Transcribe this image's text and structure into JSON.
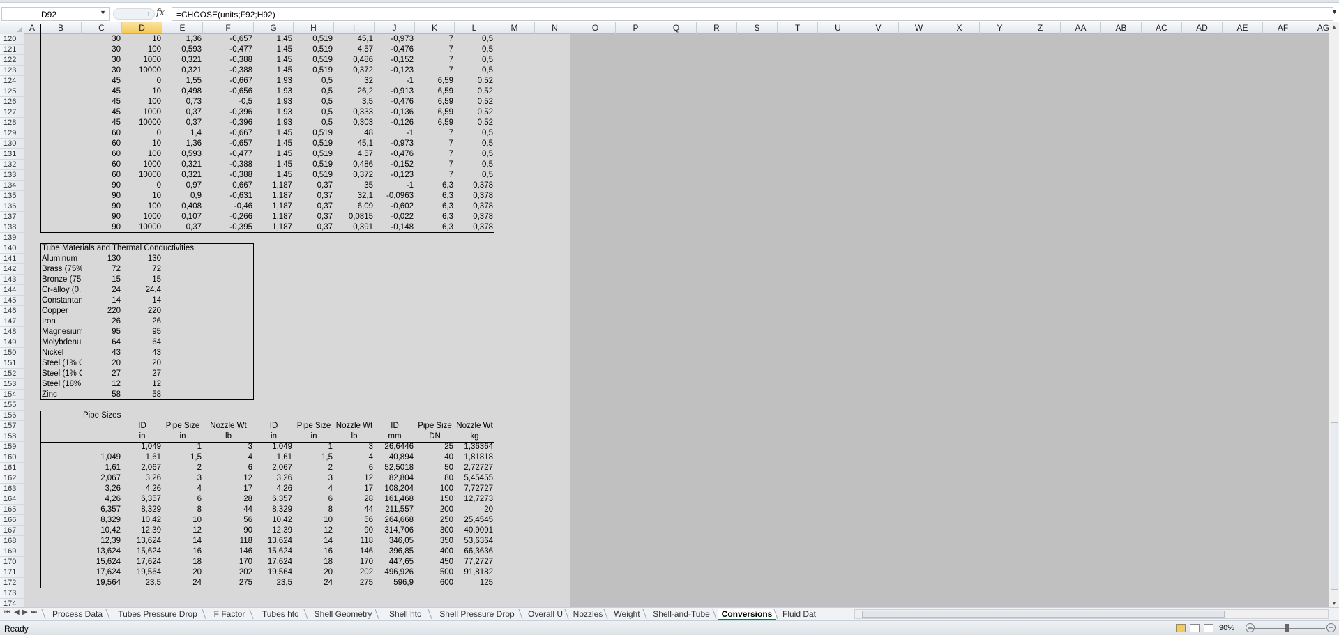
{
  "name_box": "D92",
  "formula": "=CHOOSE(units;F92;H92)",
  "fx_label": "fx",
  "columns": [
    "A",
    "B",
    "C",
    "D",
    "E",
    "F",
    "G",
    "H",
    "I",
    "J",
    "K",
    "L",
    "M",
    "N",
    "O",
    "P",
    "Q",
    "R",
    "S",
    "T",
    "U",
    "V",
    "W",
    "X",
    "Y",
    "Z",
    "AA",
    "AB",
    "AC",
    "AD",
    "AE",
    "AF",
    "AG"
  ],
  "selected_column": "D",
  "rows": [
    "120",
    "121",
    "122",
    "123",
    "124",
    "125",
    "126",
    "127",
    "128",
    "129",
    "130",
    "131",
    "132",
    "133",
    "134",
    "135",
    "136",
    "137",
    "138",
    "139",
    "140",
    "141",
    "142",
    "143",
    "144",
    "145",
    "146",
    "147",
    "148",
    "149",
    "150",
    "151",
    "152",
    "153",
    "154",
    "155",
    "156",
    "157",
    "158",
    "159",
    "160",
    "161",
    "162",
    "163",
    "164",
    "165",
    "166",
    "167",
    "168",
    "169",
    "170",
    "171",
    "172",
    "173",
    "174"
  ],
  "table1": [
    [
      "30",
      "10",
      "1,36",
      "-0,657",
      "1,45",
      "0,519",
      "45,1",
      "-0,973",
      "7",
      "0,5"
    ],
    [
      "30",
      "100",
      "0,593",
      "-0,477",
      "1,45",
      "0,519",
      "4,57",
      "-0,476",
      "7",
      "0,5"
    ],
    [
      "30",
      "1000",
      "0,321",
      "-0,388",
      "1,45",
      "0,519",
      "0,486",
      "-0,152",
      "7",
      "0,5"
    ],
    [
      "30",
      "10000",
      "0,321",
      "-0,388",
      "1,45",
      "0,519",
      "0,372",
      "-0,123",
      "7",
      "0,5"
    ],
    [
      "45",
      "0",
      "1,55",
      "-0,667",
      "1,93",
      "0,5",
      "32",
      "-1",
      "6,59",
      "0,52"
    ],
    [
      "45",
      "10",
      "0,498",
      "-0,656",
      "1,93",
      "0,5",
      "26,2",
      "-0,913",
      "6,59",
      "0,52"
    ],
    [
      "45",
      "100",
      "0,73",
      "-0,5",
      "1,93",
      "0,5",
      "3,5",
      "-0,476",
      "6,59",
      "0,52"
    ],
    [
      "45",
      "1000",
      "0,37",
      "-0,396",
      "1,93",
      "0,5",
      "0,333",
      "-0,136",
      "6,59",
      "0,52"
    ],
    [
      "45",
      "10000",
      "0,37",
      "-0,396",
      "1,93",
      "0,5",
      "0,303",
      "-0,126",
      "6,59",
      "0,52"
    ],
    [
      "60",
      "0",
      "1,4",
      "-0,667",
      "1,45",
      "0,519",
      "48",
      "-1",
      "7",
      "0,5"
    ],
    [
      "60",
      "10",
      "1,36",
      "-0,657",
      "1,45",
      "0,519",
      "45,1",
      "-0,973",
      "7",
      "0,5"
    ],
    [
      "60",
      "100",
      "0,593",
      "-0,477",
      "1,45",
      "0,519",
      "4,57",
      "-0,476",
      "7",
      "0,5"
    ],
    [
      "60",
      "1000",
      "0,321",
      "-0,388",
      "1,45",
      "0,519",
      "0,486",
      "-0,152",
      "7",
      "0,5"
    ],
    [
      "60",
      "10000",
      "0,321",
      "-0,388",
      "1,45",
      "0,519",
      "0,372",
      "-0,123",
      "7",
      "0,5"
    ],
    [
      "90",
      "0",
      "0,97",
      "0,667",
      "1,187",
      "0,37",
      "35",
      "-1",
      "6,3",
      "0,378"
    ],
    [
      "90",
      "10",
      "0,9",
      "-0,631",
      "1,187",
      "0,37",
      "32,1",
      "-0,0963",
      "6,3",
      "0,378"
    ],
    [
      "90",
      "100",
      "0,408",
      "-0,46",
      "1,187",
      "0,37",
      "6,09",
      "-0,602",
      "6,3",
      "0,378"
    ],
    [
      "90",
      "1000",
      "0,107",
      "-0,266",
      "1,187",
      "0,37",
      "0,0815",
      "-0,022",
      "6,3",
      "0,378"
    ],
    [
      "90",
      "10000",
      "0,37",
      "-0,395",
      "1,187",
      "0,37",
      "0,391",
      "-0,148",
      "6,3",
      "0,378"
    ]
  ],
  "table2": {
    "title": "Tube Materials and Thermal Conductivities",
    "rows": [
      [
        "Aluminum",
        "130",
        "130"
      ],
      [
        "Brass (75%",
        "72",
        "72"
      ],
      [
        "Bronze (75",
        "15",
        "15"
      ],
      [
        "Cr-alloy (0.",
        "24",
        "24,4"
      ],
      [
        "Constantan",
        "14",
        "14"
      ],
      [
        "Copper",
        "220",
        "220"
      ],
      [
        "Iron",
        "26",
        "26"
      ],
      [
        "Magnesium",
        "95",
        "95"
      ],
      [
        "Molybdenum",
        "64",
        "64"
      ],
      [
        "Nickel",
        "43",
        "43"
      ],
      [
        "Steel (1% C",
        "20",
        "20"
      ],
      [
        "Steel (1% C",
        "27",
        "27"
      ],
      [
        "Steel (18%",
        "12",
        "12"
      ],
      [
        "Zinc",
        "58",
        "58"
      ]
    ]
  },
  "table3": {
    "title": "Pipe Sizes",
    "header1": [
      "ID",
      "Pipe Size",
      "Nozzle Wt",
      "ID",
      "Pipe Size",
      "Nozzle Wt",
      "ID",
      "Pipe Size",
      "Nozzle Wt"
    ],
    "header2": [
      "in",
      "in",
      "lb",
      "in",
      "in",
      "lb",
      "mm",
      "DN",
      "kg"
    ],
    "rows": [
      [
        "",
        "1,049",
        "1",
        "3",
        "1,049",
        "1",
        "3",
        "26,6446",
        "25",
        "1,36364"
      ],
      [
        "1,049",
        "1,61",
        "1,5",
        "4",
        "1,61",
        "1,5",
        "4",
        "40,894",
        "40",
        "1,81818"
      ],
      [
        "1,61",
        "2,067",
        "2",
        "6",
        "2,067",
        "2",
        "6",
        "52,5018",
        "50",
        "2,72727"
      ],
      [
        "2,067",
        "3,26",
        "3",
        "12",
        "3,26",
        "3",
        "12",
        "82,804",
        "80",
        "5,45455"
      ],
      [
        "3,26",
        "4,26",
        "4",
        "17",
        "4,26",
        "4",
        "17",
        "108,204",
        "100",
        "7,72727"
      ],
      [
        "4,26",
        "6,357",
        "6",
        "28",
        "6,357",
        "6",
        "28",
        "161,468",
        "150",
        "12,7273"
      ],
      [
        "6,357",
        "8,329",
        "8",
        "44",
        "8,329",
        "8",
        "44",
        "211,557",
        "200",
        "20"
      ],
      [
        "8,329",
        "10,42",
        "10",
        "56",
        "10,42",
        "10",
        "56",
        "264,668",
        "250",
        "25,4545"
      ],
      [
        "10,42",
        "12,39",
        "12",
        "90",
        "12,39",
        "12",
        "90",
        "314,706",
        "300",
        "40,9091"
      ],
      [
        "12,39",
        "13,624",
        "14",
        "118",
        "13,624",
        "14",
        "118",
        "346,05",
        "350",
        "53,6364"
      ],
      [
        "13,624",
        "15,624",
        "16",
        "146",
        "15,624",
        "16",
        "146",
        "396,85",
        "400",
        "66,3636"
      ],
      [
        "15,624",
        "17,624",
        "18",
        "170",
        "17,624",
        "18",
        "170",
        "447,65",
        "450",
        "77,2727"
      ],
      [
        "17,624",
        "19,564",
        "20",
        "202",
        "19,564",
        "20",
        "202",
        "496,926",
        "500",
        "91,8182"
      ],
      [
        "19,564",
        "23,5",
        "24",
        "275",
        "23,5",
        "24",
        "275",
        "596,9",
        "600",
        "125"
      ]
    ]
  },
  "tabs": [
    "Process Data",
    "Tubes Pressure Drop",
    "F Factor",
    "Tubes htc",
    "Shell Geometry",
    "Shell htc",
    "Shell Pressure Drop",
    "Overall U",
    "Nozzles",
    "Weight",
    "Shell-and-Tube",
    "Conversions",
    "Fluid Dat"
  ],
  "active_tab": "Conversions",
  "status_text": "Ready",
  "zoom": "90%"
}
